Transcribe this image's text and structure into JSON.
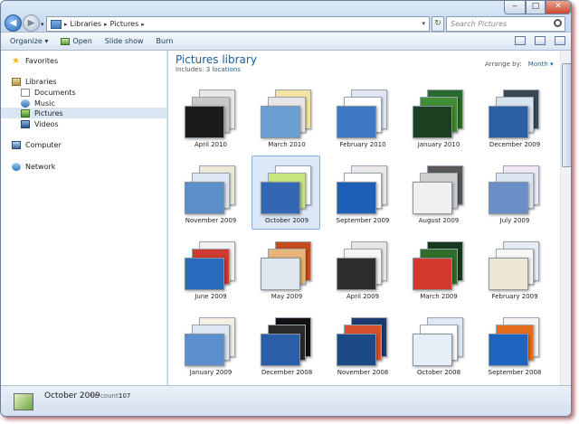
{
  "address": {
    "crumbs": [
      "Libraries",
      "Pictures"
    ],
    "search_placeholder": "Search Pictures"
  },
  "toolbar": {
    "organize": "Organize ▾",
    "open": "Open",
    "slideshow": "Slide show",
    "burn": "Burn"
  },
  "nav": {
    "favorites": "Favorites",
    "libraries": "Libraries",
    "documents": "Documents",
    "music": "Music",
    "pictures": "Pictures",
    "videos": "Videos",
    "computer": "Computer",
    "network": "Network"
  },
  "library": {
    "title": "Pictures library",
    "includes_label": "Includes:",
    "locations": "3 locations",
    "arrange_label": "Arrange by:",
    "arrange_value": "Month ▾"
  },
  "folders": [
    {
      "label": "April 2010",
      "colors": [
        "#e8e8e8",
        "#c9c9c9",
        "#1b1b1b"
      ]
    },
    {
      "label": "March 2010",
      "colors": [
        "#f4e3a2",
        "#e6e6e6",
        "#6d9fd4"
      ]
    },
    {
      "label": "February 2010",
      "colors": [
        "#dfe6f2",
        "#ffffff",
        "#3d78c4"
      ]
    },
    {
      "label": "January 2010",
      "colors": [
        "#2a6a2c",
        "#3f8f34",
        "#1d3f22"
      ]
    },
    {
      "label": "December 2009",
      "colors": [
        "#3a4654",
        "#d8e4f0",
        "#2b5fa4"
      ]
    },
    {
      "label": "November 2009",
      "colors": [
        "#ece9d8",
        "#dfe8f5",
        "#5a8fc8"
      ]
    },
    {
      "label": "October 2009",
      "colors": [
        "#fdfdfd",
        "#c8e67e",
        "#3467b3"
      ]
    },
    {
      "label": "September 2009",
      "colors": [
        "#e9e9e9",
        "#ffffff",
        "#1d5fb8"
      ]
    },
    {
      "label": "August 2009",
      "colors": [
        "#585858",
        "#cfcfcf",
        "#f0f0f0"
      ]
    },
    {
      "label": "July 2009",
      "colors": [
        "#f0e9f2",
        "#dde7f3",
        "#6a8fc7"
      ]
    },
    {
      "label": "June 2009",
      "colors": [
        "#f2f2f2",
        "#cf3b32",
        "#2b6bbd"
      ]
    },
    {
      "label": "May 2009",
      "colors": [
        "#c44a1e",
        "#e7b47a",
        "#dfe6ee"
      ]
    },
    {
      "label": "April 2009",
      "colors": [
        "#e6e6e6",
        "#f5f5f5",
        "#2e2e2e"
      ]
    },
    {
      "label": "March 2009",
      "colors": [
        "#16381d",
        "#2e6e2a",
        "#d33a2c"
      ]
    },
    {
      "label": "February 2009",
      "colors": [
        "#e7edf5",
        "#f7f7f7",
        "#ede7d4"
      ]
    },
    {
      "label": "January 2009",
      "colors": [
        "#f3efe2",
        "#dfe9f6",
        "#5d8fcf"
      ]
    },
    {
      "label": "December 2008",
      "colors": [
        "#111111",
        "#2a2a2a",
        "#2b5ea8"
      ]
    },
    {
      "label": "November 2008",
      "colors": [
        "#1b3a6d",
        "#d9502d",
        "#1c4a86"
      ]
    },
    {
      "label": "October 2008",
      "colors": [
        "#dfe9f4",
        "#ffffff",
        "#e6eef8"
      ]
    },
    {
      "label": "September 2008",
      "colors": [
        "#f4f4f4",
        "#e66c1d",
        "#1d63c0"
      ]
    }
  ],
  "status": {
    "name": "October 2009",
    "count_label": "File count:",
    "count": "107"
  }
}
